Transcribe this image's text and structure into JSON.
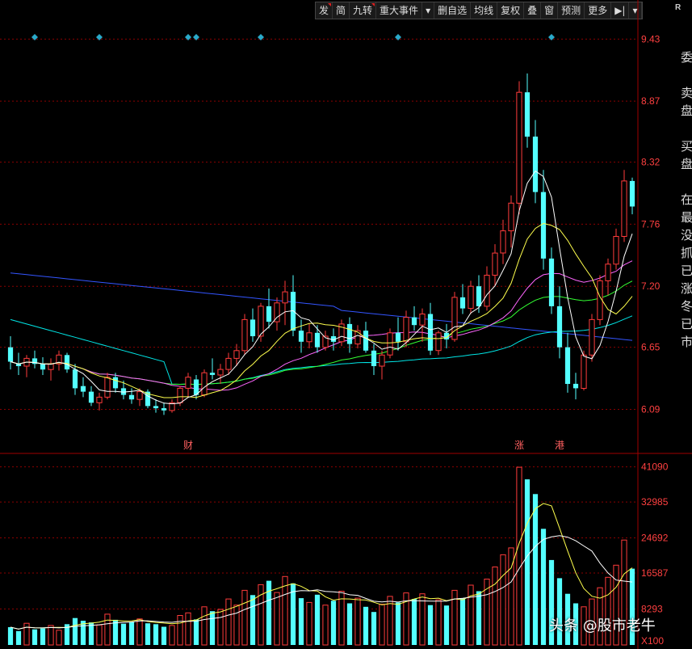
{
  "toolbar": {
    "items": [
      "发",
      "简",
      "九转",
      "重大事件",
      "▾",
      "删自选",
      "均线",
      "复权",
      "叠",
      "窗",
      "预测",
      "更多",
      "▶|",
      "▾"
    ],
    "marked": [
      true,
      false,
      true,
      false,
      false,
      false,
      false,
      false,
      false,
      false,
      false,
      false,
      false,
      false
    ],
    "corner": "R"
  },
  "side_text": [
    "委",
    "",
    "卖",
    "盘",
    "",
    "买",
    "盘",
    "",
    "在",
    "最",
    "没",
    "抓",
    "已",
    "涨",
    "冬",
    "已",
    "市"
  ],
  "watermark": "头条 @股市老牛",
  "colors": {
    "up": "#ff3b3b",
    "down": "#54ffff",
    "ma5": "#ffffff",
    "ma10": "#ffff4d",
    "ma20": "#ff66ff",
    "ma30": "#33ff33",
    "ma60": "#00e6e6",
    "ma120": "#3355ff",
    "grid": "#8b0000",
    "axis_text": "#ff4040",
    "marker": "#2aa9c9"
  },
  "chart_data": {
    "type": "candlestick",
    "price_axis": {
      "ticks": [
        "9.43",
        "8.87",
        "8.32",
        "7.76",
        "7.20",
        "6.65",
        "6.09"
      ],
      "ylim": [
        5.7,
        9.6
      ]
    },
    "volume_axis": {
      "ticks": [
        "41090",
        "32985",
        "24692",
        "16587",
        "8293"
      ],
      "unit": "X100",
      "ylim": [
        0,
        44000
      ]
    },
    "event_labels": [
      {
        "index": 22,
        "text": "财"
      },
      {
        "index": 63,
        "text": "涨"
      },
      {
        "index": 68,
        "text": "港"
      }
    ],
    "top_markers": [
      3,
      11,
      22,
      23,
      31,
      48,
      67
    ],
    "ohlc": [
      [
        6.65,
        6.75,
        6.45,
        6.52
      ],
      [
        6.5,
        6.6,
        6.4,
        6.48
      ],
      [
        6.48,
        6.58,
        6.38,
        6.55
      ],
      [
        6.55,
        6.62,
        6.46,
        6.5
      ],
      [
        6.5,
        6.56,
        6.4,
        6.45
      ],
      [
        6.45,
        6.55,
        6.35,
        6.5
      ],
      [
        6.5,
        6.62,
        6.44,
        6.58
      ],
      [
        6.58,
        6.6,
        6.42,
        6.45
      ],
      [
        6.45,
        6.5,
        6.22,
        6.28
      ],
      [
        6.3,
        6.38,
        6.2,
        6.25
      ],
      [
        6.25,
        6.3,
        6.12,
        6.15
      ],
      [
        6.15,
        6.24,
        6.08,
        6.2
      ],
      [
        6.2,
        6.42,
        6.18,
        6.38
      ],
      [
        6.38,
        6.42,
        6.24,
        6.28
      ],
      [
        6.28,
        6.35,
        6.18,
        6.22
      ],
      [
        6.22,
        6.28,
        6.14,
        6.18
      ],
      [
        6.18,
        6.28,
        6.12,
        6.25
      ],
      [
        6.25,
        6.27,
        6.1,
        6.12
      ],
      [
        6.12,
        6.18,
        6.06,
        6.1
      ],
      [
        6.1,
        6.15,
        6.04,
        6.08
      ],
      [
        6.08,
        6.18,
        6.06,
        6.15
      ],
      [
        6.15,
        6.3,
        6.12,
        6.28
      ],
      [
        6.28,
        6.42,
        6.2,
        6.38
      ],
      [
        6.36,
        6.4,
        6.18,
        6.22
      ],
      [
        6.22,
        6.45,
        6.2,
        6.42
      ],
      [
        6.42,
        6.55,
        6.36,
        6.4
      ],
      [
        6.4,
        6.5,
        6.32,
        6.45
      ],
      [
        6.45,
        6.6,
        6.4,
        6.55
      ],
      [
        6.55,
        6.68,
        6.48,
        6.62
      ],
      [
        6.62,
        6.95,
        6.58,
        6.9
      ],
      [
        6.9,
        7.0,
        6.7,
        6.75
      ],
      [
        6.75,
        7.05,
        6.7,
        7.02
      ],
      [
        7.02,
        7.18,
        6.82,
        6.88
      ],
      [
        6.88,
        7.1,
        6.8,
        7.05
      ],
      [
        7.05,
        7.25,
        6.85,
        7.15
      ],
      [
        7.15,
        7.3,
        6.75,
        6.8
      ],
      [
        6.8,
        6.9,
        6.6,
        6.7
      ],
      [
        6.7,
        6.86,
        6.64,
        6.78
      ],
      [
        6.78,
        6.85,
        6.6,
        6.65
      ],
      [
        6.65,
        6.8,
        6.62,
        6.75
      ],
      [
        6.75,
        6.82,
        6.62,
        6.7
      ],
      [
        6.7,
        6.9,
        6.66,
        6.86
      ],
      [
        6.86,
        6.92,
        6.6,
        6.68
      ],
      [
        6.68,
        6.85,
        6.64,
        6.8
      ],
      [
        6.8,
        6.88,
        6.6,
        6.62
      ],
      [
        6.62,
        6.68,
        6.4,
        6.48
      ],
      [
        6.48,
        6.62,
        6.36,
        6.58
      ],
      [
        6.58,
        6.82,
        6.55,
        6.78
      ],
      [
        6.78,
        6.92,
        6.62,
        6.7
      ],
      [
        6.7,
        6.98,
        6.65,
        6.92
      ],
      [
        6.92,
        7.02,
        6.8,
        6.85
      ],
      [
        6.85,
        7.0,
        6.7,
        6.95
      ],
      [
        6.95,
        7.05,
        6.58,
        6.62
      ],
      [
        6.62,
        6.8,
        6.58,
        6.78
      ],
      [
        6.78,
        6.86,
        6.64,
        6.72
      ],
      [
        6.72,
        7.15,
        6.7,
        7.1
      ],
      [
        7.1,
        7.22,
        6.95,
        7.0
      ],
      [
        7.0,
        7.25,
        6.95,
        7.2
      ],
      [
        7.2,
        7.3,
        6.96,
        7.02
      ],
      [
        7.02,
        7.38,
        6.98,
        7.3
      ],
      [
        7.3,
        7.58,
        7.2,
        7.5
      ],
      [
        7.5,
        7.8,
        7.4,
        7.7
      ],
      [
        7.7,
        8.02,
        7.55,
        7.95
      ],
      [
        7.95,
        9.05,
        7.85,
        8.95
      ],
      [
        8.95,
        9.12,
        8.45,
        8.55
      ],
      [
        8.55,
        8.7,
        7.95,
        8.05
      ],
      [
        8.05,
        8.25,
        7.35,
        7.45
      ],
      [
        7.45,
        7.55,
        6.95,
        7.02
      ],
      [
        7.02,
        7.2,
        6.55,
        6.65
      ],
      [
        6.65,
        6.78,
        6.24,
        6.32
      ],
      [
        6.32,
        6.42,
        6.18,
        6.28
      ],
      [
        6.28,
        6.62,
        6.26,
        6.58
      ],
      [
        6.58,
        6.95,
        6.52,
        6.9
      ],
      [
        6.9,
        7.3,
        6.85,
        7.25
      ],
      [
        7.25,
        7.45,
        7.12,
        7.4
      ],
      [
        7.4,
        7.72,
        7.35,
        7.65
      ],
      [
        7.65,
        8.25,
        7.6,
        8.15
      ],
      [
        8.15,
        8.18,
        7.85,
        7.92
      ]
    ],
    "volume": [
      4100,
      3200,
      5000,
      3600,
      3800,
      4500,
      3400,
      4800,
      6200,
      5600,
      5200,
      4600,
      7100,
      5800,
      4900,
      5300,
      6000,
      5000,
      4800,
      4200,
      4500,
      6800,
      7400,
      5900,
      8800,
      7800,
      8200,
      10600,
      9200,
      12600,
      11500,
      13900,
      14800,
      12100,
      15800,
      14200,
      10800,
      9800,
      11600,
      9200,
      10200,
      12400,
      9600,
      10800,
      8800,
      7600,
      9400,
      11200,
      9800,
      12000,
      10600,
      11800,
      9200,
      10400,
      9100,
      12600,
      10800,
      13800,
      12400,
      15200,
      18000,
      20800,
      22400,
      41000,
      38200,
      34800,
      26800,
      19600,
      15400,
      11800,
      9600,
      8800,
      10600,
      13200,
      15600,
      18400,
      24200,
      17600
    ],
    "ma_lines": {
      "ma5": "white",
      "ma10": "yellow",
      "ma20": "magenta",
      "ma30": "green",
      "ma60": "cyan",
      "ma120": "blue"
    }
  }
}
